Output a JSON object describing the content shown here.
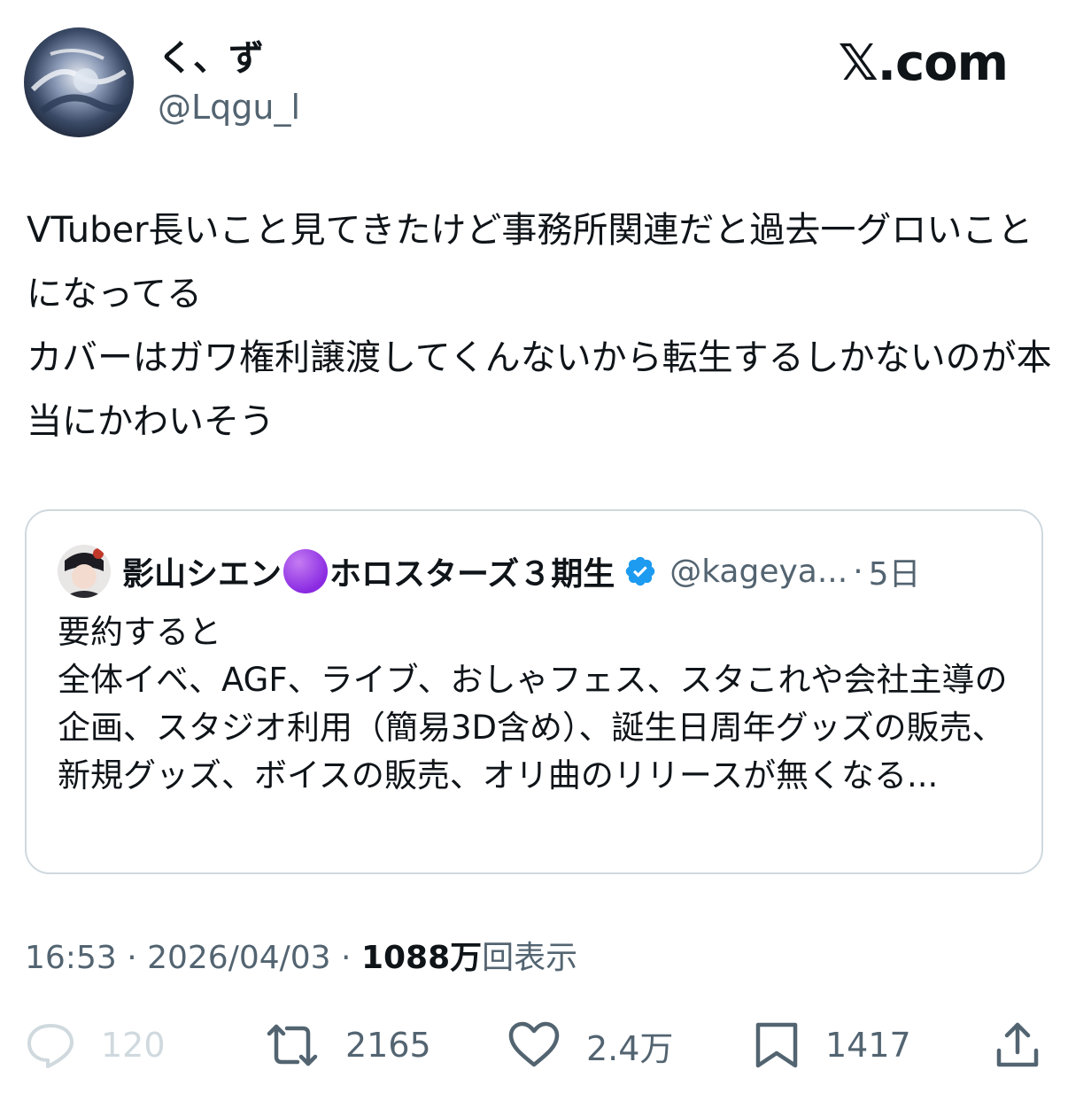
{
  "author": {
    "display_name": "く、ず",
    "handle": "@Lqgu_l",
    "avatar_icon": "profile-avatar"
  },
  "site": {
    "logo": "𝕏.com"
  },
  "tweet": {
    "text": "VTuber長いこと見てきたけど事務所関連だと過去一グロいことになってる\nカバーはガワ権利譲渡してくんないから転生するしかないのが本当にかわいそう"
  },
  "quote": {
    "name_part1": "影山シエン",
    "name_emoji": "purple-circle",
    "name_part2": "ホロスターズ３期生",
    "verified_icon": "verified-badge-icon",
    "handle": "@kageya...",
    "separator": "·",
    "time": "5日",
    "text": "要約すると\n全体イベ、AGF、ライブ、おしゃフェス、スタこれや会社主導の企画、スタジオ利用（簡易3D含め）、誕生日周年グッズの販売、新規グッズ、ボイスの販売、オリ曲のリリースが無くなる..."
  },
  "meta": {
    "time": "16:53",
    "sep1": " · ",
    "date": "2026/04/03",
    "sep2": " · ",
    "views_number": "1088万",
    "views_label": "回表示"
  },
  "actions": {
    "reply": {
      "icon": "reply-icon",
      "count": "120"
    },
    "retweet": {
      "icon": "retweet-icon",
      "count": "2165"
    },
    "like": {
      "icon": "heart-icon",
      "count": "2.4万"
    },
    "bookmark": {
      "icon": "bookmark-icon",
      "count": "1417"
    },
    "share": {
      "icon": "share-icon"
    }
  },
  "colors": {
    "text": "#0f1419",
    "secondary": "#536471",
    "verified": "#1d9bf0",
    "border": "#cfd9de"
  }
}
